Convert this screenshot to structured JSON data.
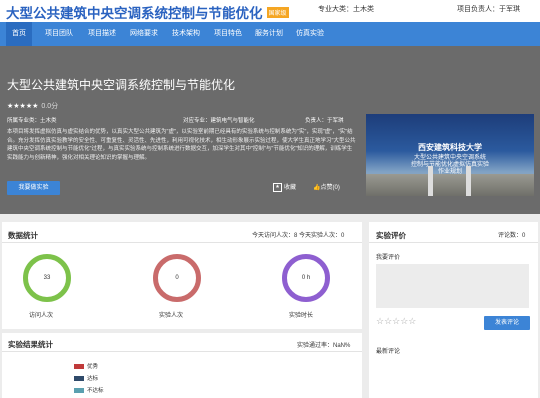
{
  "header": {
    "title": "大型公共建筑中央空调系统控制与节能优化",
    "badge": "国家级",
    "major": "专业大类：土木类",
    "leader": "项目负责人：于军琪"
  },
  "nav": [
    "首页",
    "项目团队",
    "项目描述",
    "网络要求",
    "技术架构",
    "项目特色",
    "服务计划",
    "仿真实验"
  ],
  "hero": {
    "title": "大型公共建筑中央空调系统控制与节能优化",
    "stars": "★★★★★",
    "rating": "0.0分",
    "category": "所属专业类：土木类",
    "major": "对应专业：建筑电气与智能化",
    "leader": "负责人：于军琪",
    "description": "本项目将发挥虚拟仿真与虚实结合的优势，以真实大型公共建筑为\"虚\"，以实验室前期已经具有的实验系统与控制系统为\"实\"，实现\"虚\"，\"实\"结合。充分发挥仿真实验教学的安全性、可重复性、灵活性、先进性，利用可视化技术，相生动形象展示实验过程，使大学生真正地学习\"大型公共建筑中央空调系统控制与节能优化\"过程，与真实实验系统与控制系统进行数据交互，加深学生对其中\"控制\"与\"节能优化\"知识的理解，训练学生实践能力与创新精神，强化对相关理论知识的掌握与理解。",
    "start_btn": "我要做实验",
    "fav": "收藏",
    "like": "点赞(0)",
    "poster_line1": "西安建筑科技大学",
    "poster_line2": "大型公共建筑中央空调系统",
    "poster_line3": "控制与节能优化虚拟仿真实验",
    "poster_line4": "作业规划"
  },
  "stats": {
    "title": "数据统计",
    "today": "今天访问人次：8   今天实验人次：0",
    "rings": [
      {
        "value": "33",
        "label": "访问人次",
        "color": "#7dc24a"
      },
      {
        "value": "0",
        "label": "实验人次",
        "color": "#c96b6b"
      },
      {
        "value": "0 h",
        "label": "实验时长",
        "color": "#8e5fd0"
      }
    ]
  },
  "results": {
    "title": "实验结果统计",
    "pass_rate": "实验通过率：NaN%",
    "legend": [
      {
        "label": "优秀",
        "color": "#c03a3a"
      },
      {
        "label": "达标",
        "color": "#2f4a6a"
      },
      {
        "label": "不达标",
        "color": "#5aa0b0"
      }
    ]
  },
  "review": {
    "title": "实验评价",
    "count": "评论数：0",
    "my_review": "我要评价",
    "rating_stars": "☆☆☆☆☆",
    "submit": "发表评论",
    "latest": "最新评论"
  }
}
